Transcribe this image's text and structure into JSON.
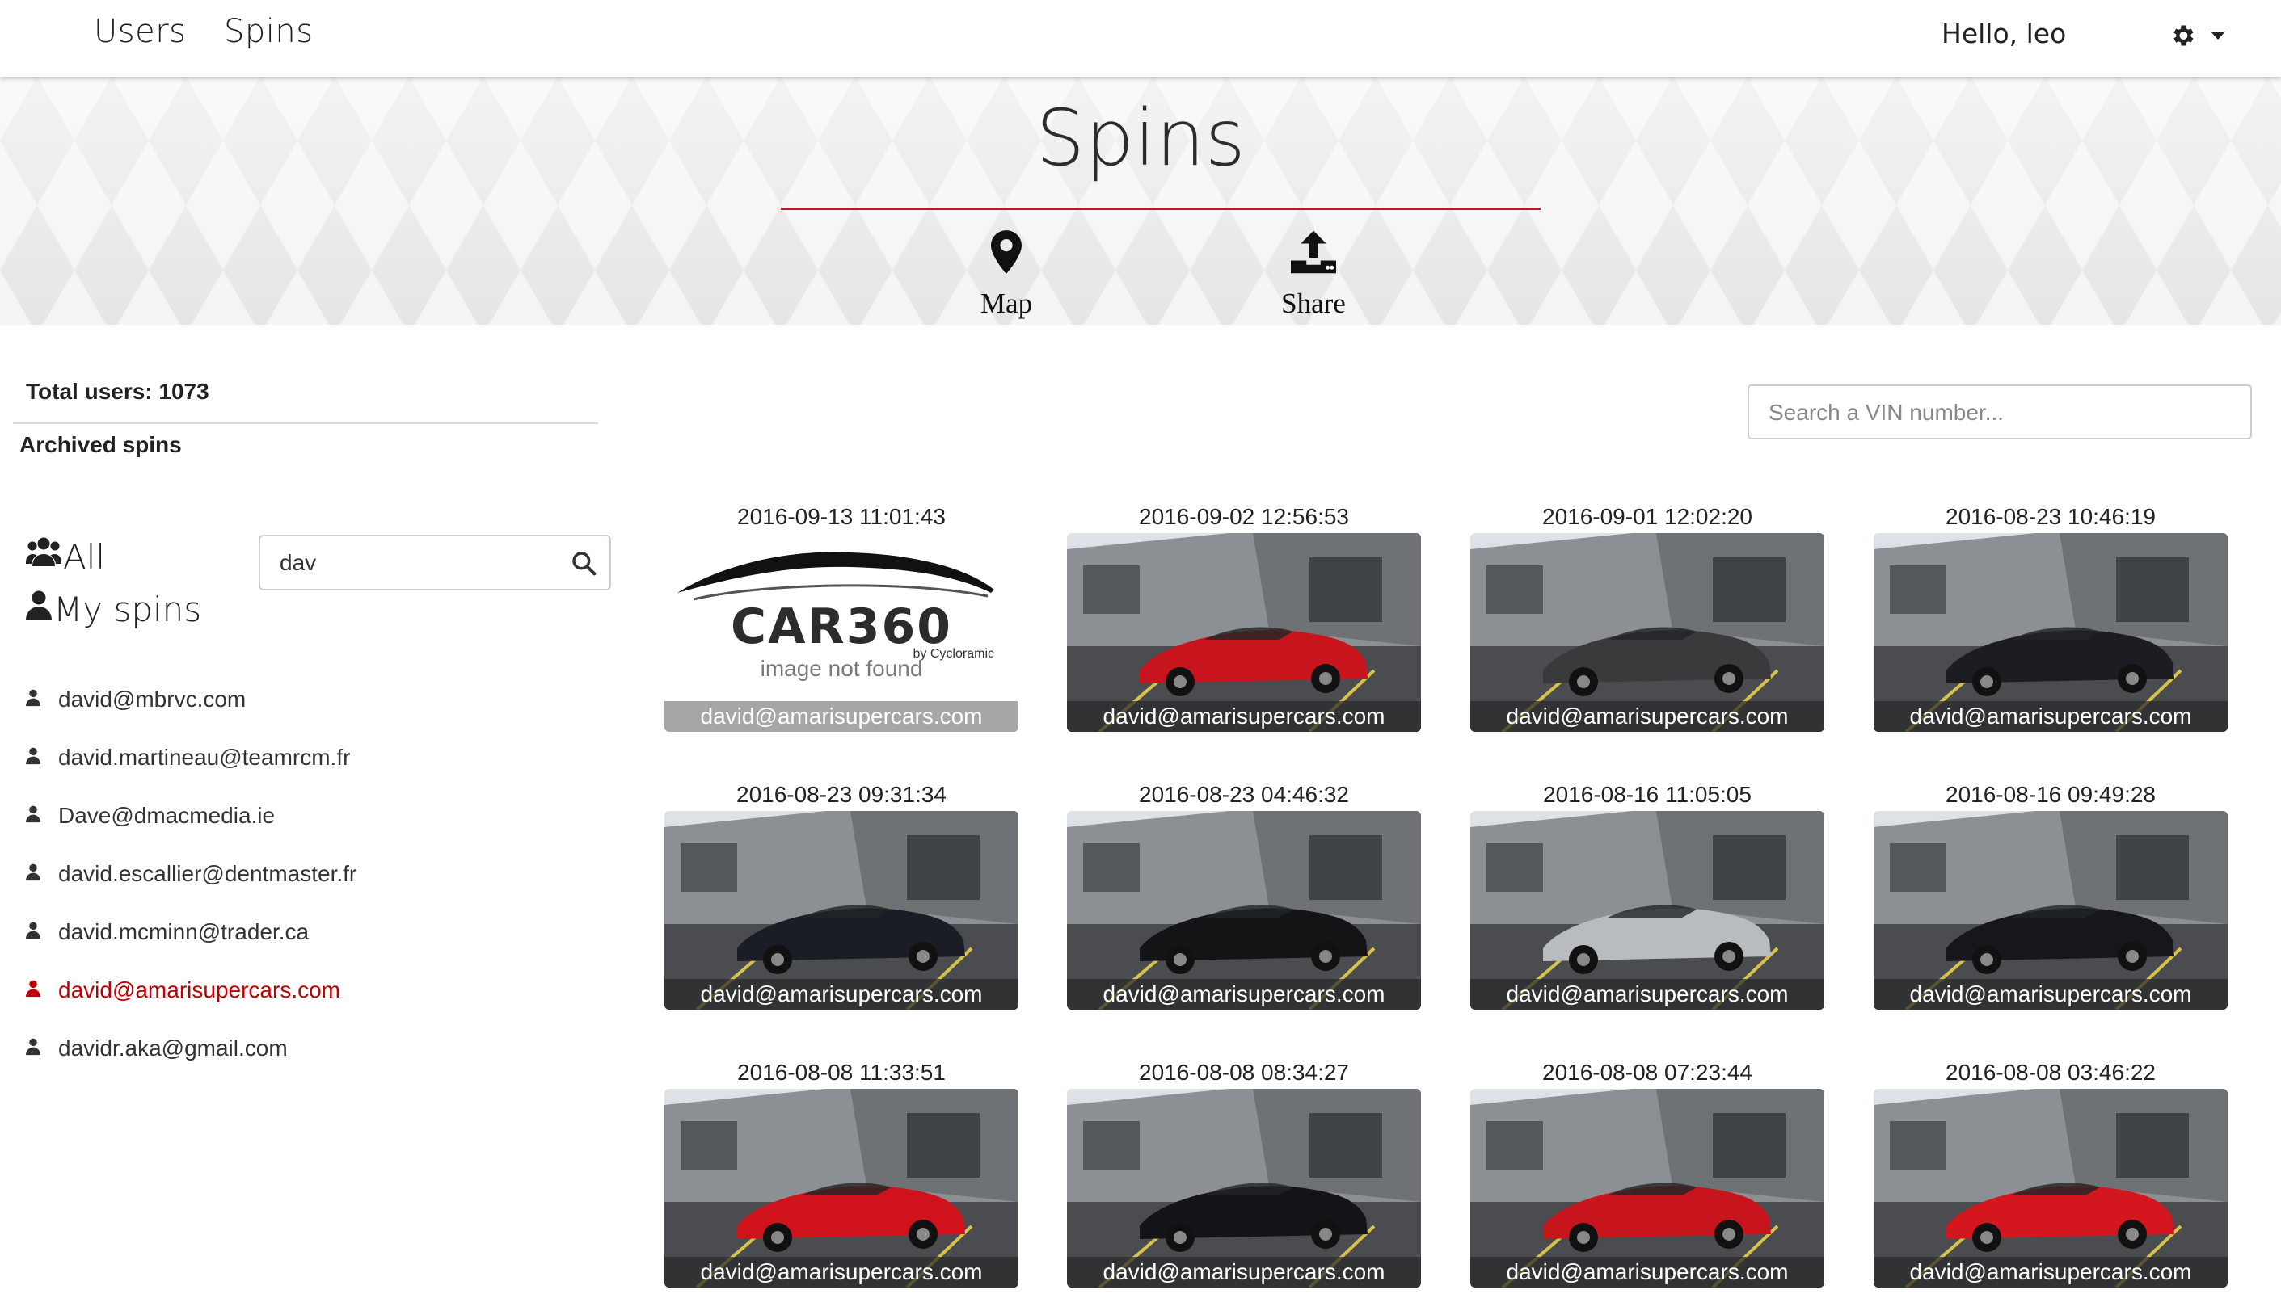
{
  "nav": {
    "users_label": "Users",
    "spins_label": "Spins",
    "greeting": "Hello, leo"
  },
  "hero": {
    "title": "Spins",
    "map_label": "Map",
    "share_label": "Share"
  },
  "sidebar": {
    "total_users": "Total users: 1073",
    "archived_label": "Archived spins",
    "filter_all": "All",
    "filter_mine": "My spins",
    "search_value": "dav",
    "users": [
      {
        "email": "david@mbrvc.com",
        "active": false
      },
      {
        "email": "david.martineau@teamrcm.fr",
        "active": false
      },
      {
        "email": "Dave@dmacmedia.ie",
        "active": false
      },
      {
        "email": "david.escallier@dentmaster.fr",
        "active": false
      },
      {
        "email": "david.mcminn@trader.ca",
        "active": false
      },
      {
        "email": "david@amarisupercars.com",
        "active": true
      },
      {
        "email": "davidr.aka@gmail.com",
        "active": false
      }
    ]
  },
  "vin_search": {
    "placeholder": "Search a VIN number..."
  },
  "spins": [
    {
      "date": "2016-09-13 11:01:43",
      "owner": "david@amarisupercars.com",
      "image": "not-found",
      "logo_text": "CAR360",
      "logo_sub": "by Cycloramic",
      "not_found_text": "image not found"
    },
    {
      "date": "2016-09-02 12:56:53",
      "owner": "david@amarisupercars.com",
      "car_color": "#c8141c"
    },
    {
      "date": "2016-09-01 12:02:20",
      "owner": "david@amarisupercars.com",
      "car_color": "#3a3a3c"
    },
    {
      "date": "2016-08-23 10:46:19",
      "owner": "david@amarisupercars.com",
      "car_color": "#1c1c22"
    },
    {
      "date": "2016-08-23 09:31:34",
      "owner": "david@amarisupercars.com",
      "car_color": "#1a1c26"
    },
    {
      "date": "2016-08-23 04:46:32",
      "owner": "david@amarisupercars.com",
      "car_color": "#141416"
    },
    {
      "date": "2016-08-16 11:05:05",
      "owner": "david@amarisupercars.com",
      "car_color": "#b8bcc0"
    },
    {
      "date": "2016-08-16 09:49:28",
      "owner": "david@amarisupercars.com",
      "car_color": "#16161c"
    },
    {
      "date": "2016-08-08 11:33:51",
      "owner": "david@amarisupercars.com",
      "car_color": "#d0121c"
    },
    {
      "date": "2016-08-08 08:34:27",
      "owner": "david@amarisupercars.com",
      "car_color": "#141418"
    },
    {
      "date": "2016-08-08 07:23:44",
      "owner": "david@amarisupercars.com",
      "car_color": "#c8141c"
    },
    {
      "date": "2016-08-08 03:46:22",
      "owner": "david@amarisupercars.com",
      "car_color": "#d4161e"
    }
  ],
  "colors": {
    "accent": "#c8102e",
    "active_user": "#c00000"
  },
  "icons": {
    "gear": "gear-icon",
    "map": "map-marker-icon",
    "share": "upload-icon",
    "users": "users-icon",
    "user": "user-icon",
    "search": "search-icon"
  }
}
